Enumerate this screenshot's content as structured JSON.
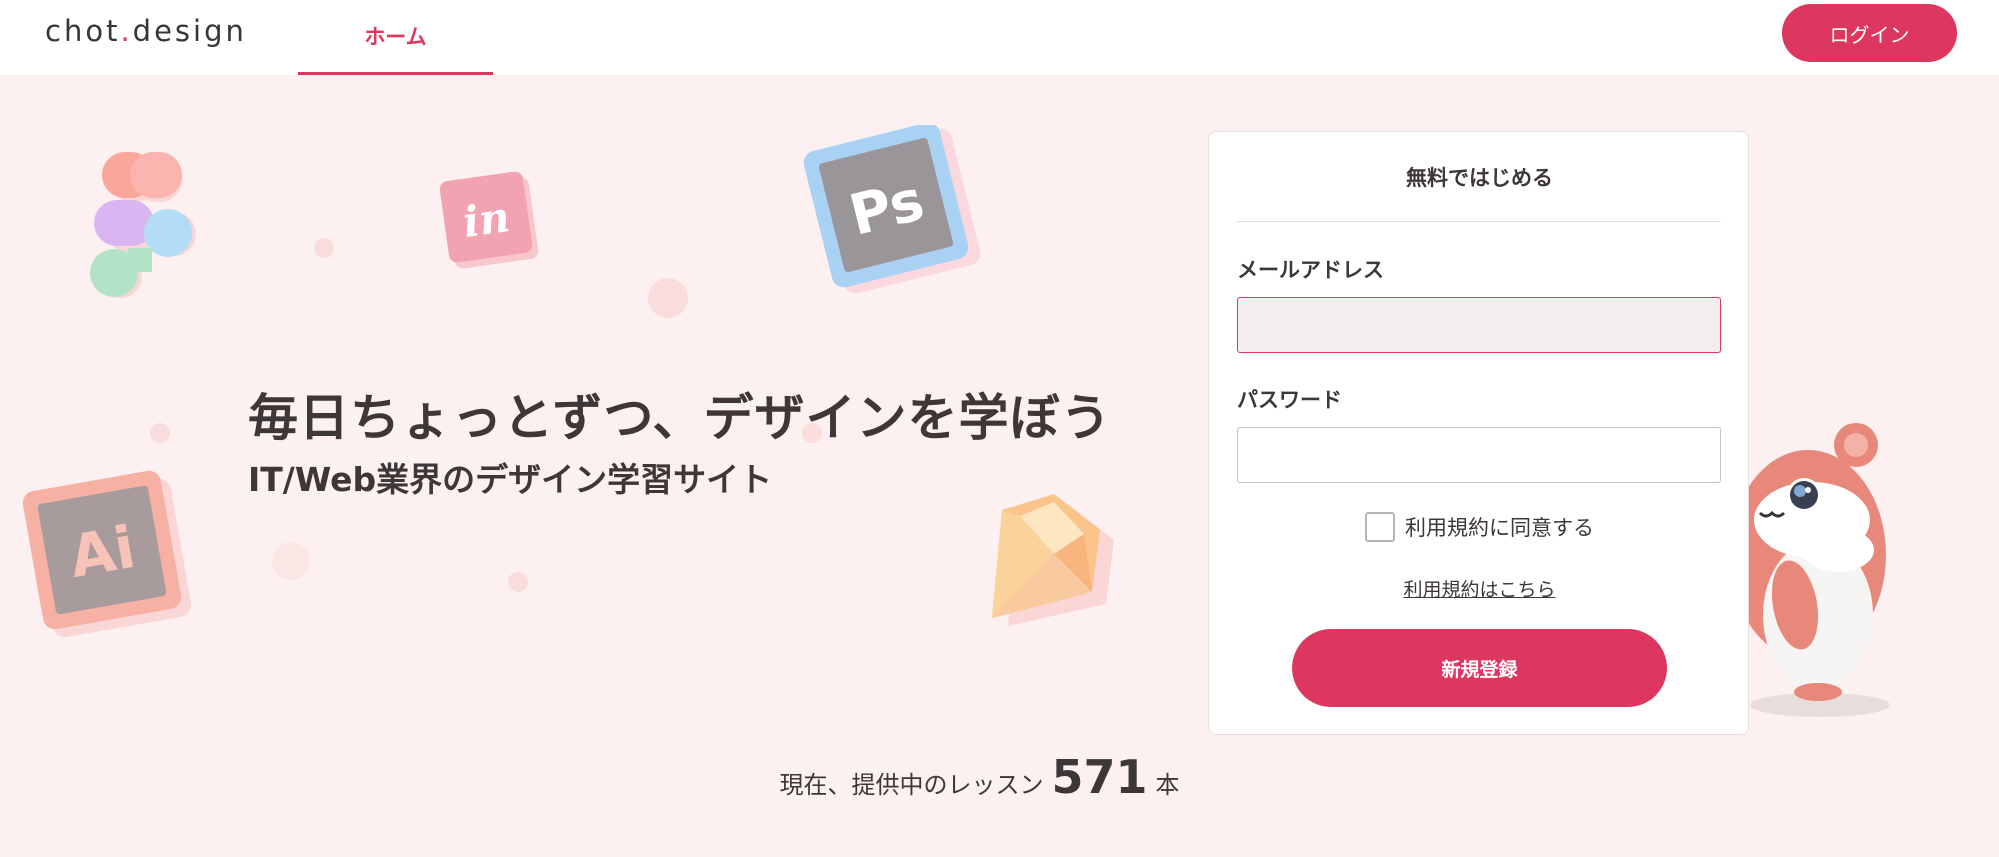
{
  "header": {
    "logo_pre": "chot",
    "logo_dot": ".",
    "logo_post": "design",
    "nav_home": "ホーム",
    "login_label": "ログイン"
  },
  "hero": {
    "title": "毎日ちょっとずつ、デザインを学ぼう",
    "subtitle": "IT/Web業界のデザイン学習サイト"
  },
  "decorations": {
    "ai_icon": "Ai",
    "ps_icon": "Ps",
    "invision_icon": "in"
  },
  "signup_card": {
    "title": "無料ではじめる",
    "email_label": "メールアドレス",
    "email_value": "",
    "password_label": "パスワード",
    "password_value": "",
    "agree_label": "利用規約に同意する",
    "terms_link": "利用規約はこちら",
    "submit_label": "新規登録"
  },
  "lessons": {
    "prefix": "現在、提供中のレッスン",
    "count": "571",
    "unit": "本"
  },
  "colors": {
    "accent": "#dd3760",
    "background": "#fdf0f0",
    "text": "#3d3737"
  }
}
